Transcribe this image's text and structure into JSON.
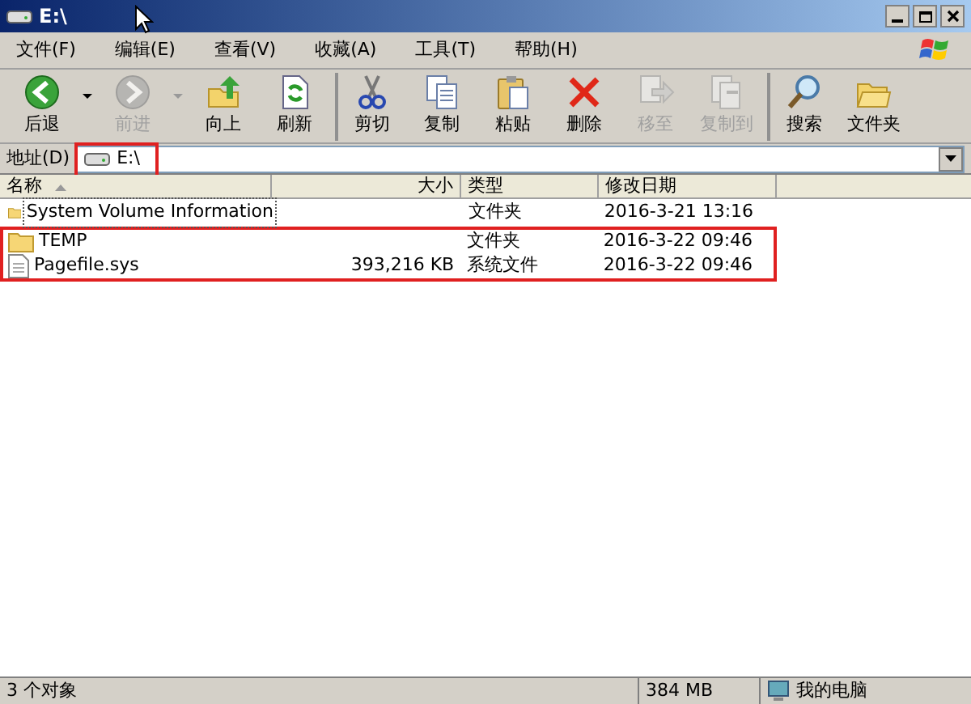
{
  "window": {
    "title": "E:\\"
  },
  "menu": [
    {
      "label": "文件(F)"
    },
    {
      "label": "编辑(E)"
    },
    {
      "label": "查看(V)"
    },
    {
      "label": "收藏(A)"
    },
    {
      "label": "工具(T)"
    },
    {
      "label": "帮助(H)"
    }
  ],
  "toolbar": [
    {
      "kind": "back",
      "label": "后退",
      "disabled": false,
      "dropdown": true
    },
    {
      "kind": "forward",
      "label": "前进",
      "disabled": true,
      "dropdown": true
    },
    {
      "kind": "up",
      "label": "向上",
      "disabled": false,
      "dropdown": false
    },
    {
      "kind": "refresh",
      "label": "刷新",
      "disabled": false,
      "dropdown": false
    },
    {
      "kind": "cut",
      "label": "剪切",
      "disabled": false,
      "dropdown": false,
      "separator_before": true
    },
    {
      "kind": "copy",
      "label": "复制",
      "disabled": false,
      "dropdown": false
    },
    {
      "kind": "paste",
      "label": "粘贴",
      "disabled": false,
      "dropdown": false
    },
    {
      "kind": "delete",
      "label": "删除",
      "disabled": false,
      "dropdown": false
    },
    {
      "kind": "move",
      "label": "移至",
      "disabled": true,
      "dropdown": false
    },
    {
      "kind": "copyto",
      "label": "复制到",
      "disabled": true,
      "dropdown": false
    },
    {
      "kind": "search",
      "label": "搜索",
      "disabled": false,
      "dropdown": false,
      "separator_before": true
    },
    {
      "kind": "folders",
      "label": "文件夹",
      "disabled": false,
      "dropdown": false
    }
  ],
  "address": {
    "label": "地址(D)",
    "value": "E:\\",
    "highlighted": true
  },
  "table": {
    "columns": [
      {
        "label": "名称",
        "sorted": true
      },
      {
        "label": "大小",
        "sorted": false
      },
      {
        "label": "类型",
        "sorted": false
      },
      {
        "label": "修改日期",
        "sorted": false
      }
    ],
    "rows": [
      {
        "kind": "folder",
        "name": "System Volume Information",
        "size": "",
        "type": "文件夹",
        "modified": "2016-3-21 13:16",
        "focused": true,
        "highlighted": false
      },
      {
        "kind": "folder",
        "name": "TEMP",
        "size": "",
        "type": "文件夹",
        "modified": "2016-3-22 09:46",
        "focused": false,
        "highlighted": true
      },
      {
        "kind": "file",
        "name": "Pagefile.sys",
        "size": "393,216 KB",
        "type": "系统文件",
        "modified": "2016-3-22 09:46",
        "focused": false,
        "highlighted": true
      }
    ]
  },
  "status_bar": {
    "count": "3 个对象",
    "size": "384 MB",
    "zone": "我的电脑"
  }
}
